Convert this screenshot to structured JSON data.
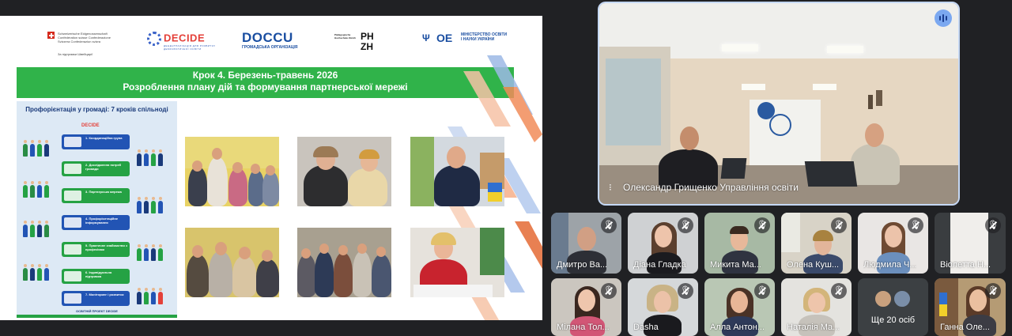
{
  "slide": {
    "logos": {
      "swiss_text": "Schweizerische Eidgenossenschaft Confédération suisse Confederazione Svizzera Confederaziun svizra",
      "swiss_sub": "За підтримки Швейцарії",
      "decide": "DECIDE",
      "decide_sub": "ДЕЦЕНТРАЛІЗАЦІЯ ДЛЯ РОЗВИТКУ ДЕМОКРАТИЧНОЇ ОСВІТИ",
      "doccu": "DOCCU",
      "doccu_sub": "ГРОМАДСЬКА ОРГАНІЗАЦІЯ",
      "phzh_small": "Pädagogische Hochschule Zürich",
      "phzh_big": "PH ZH",
      "mon_text": "МІНІСТЕРСТВО ОСВІТИ І НАУКИ УКРАЇНИ",
      "mon_mark": "ОЕ"
    },
    "banner": {
      "line1": "Крок 4. Березень-травень 2026",
      "line2": "Розроблення плану дій та формування партнерської мережі"
    },
    "poster": {
      "title": "Профорієнтація у громаді: 7 кроків спільноді",
      "logo": "DECIDE",
      "footer": "ОСВІТНІЙ ПРОЕКТ DECIDE",
      "steps": [
        {
          "label": "1. Координаційна група",
          "color": "blue"
        },
        {
          "label": "2. Дослідження потреб громади",
          "color": "green"
        },
        {
          "label": "3. Партнерська мережа",
          "color": "green"
        },
        {
          "label": "4. Профорієнтаційне інформування",
          "color": "blue"
        },
        {
          "label": "5. Практичне знайомство з професіями",
          "color": "green"
        },
        {
          "label": "6. Індивідуальна підтримка",
          "color": "green"
        },
        {
          "label": "7. Моніторинг і розвиток",
          "color": "blue"
        }
      ]
    }
  },
  "meet": {
    "main_speaker": "Олександр Грищенко Управління освіти",
    "participants": [
      {
        "name": "Дмитро Ва..."
      },
      {
        "name": "Діана Гладка"
      },
      {
        "name": "Микита Ма..."
      },
      {
        "name": "Олена Куш..."
      },
      {
        "name": "Людмила Ч..."
      },
      {
        "name": "Віолетта Н..."
      },
      {
        "name": "Мілана Тол..."
      },
      {
        "name": "Dasha"
      },
      {
        "name": "Алла Антон..."
      },
      {
        "name": "Наталія Ма..."
      },
      {
        "name": "Ганна Оле..."
      }
    ],
    "more_label": "Ще 20 осіб"
  }
}
